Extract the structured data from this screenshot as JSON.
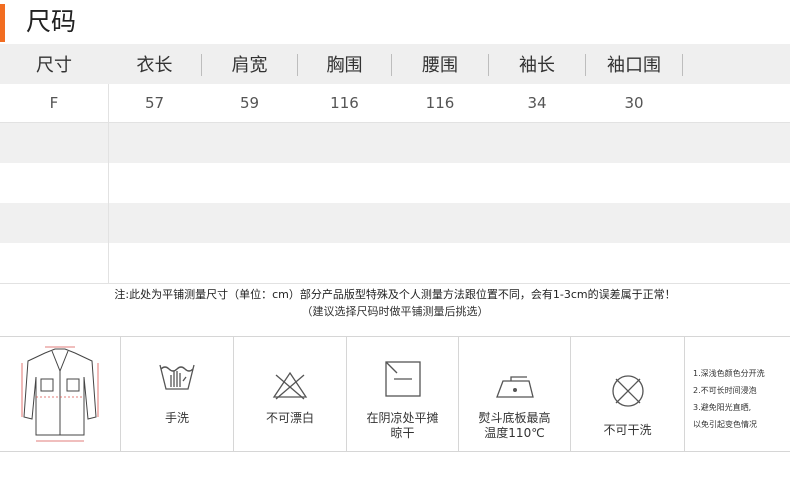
{
  "title": "尺码",
  "table": {
    "headers": [
      "尺寸",
      "衣长",
      "肩宽",
      "胸围",
      "腰围",
      "袖长",
      "袖口围"
    ],
    "rows": [
      [
        "F",
        "57",
        "59",
        "116",
        "116",
        "34",
        "30"
      ]
    ]
  },
  "note": {
    "line1": "注:此处为平铺测量尺寸（单位：cm）部分产品版型特殊及个人测量方法跟位置不同，会有1-3cm的误差属于正常！",
    "line2": "（建议选择尺码时做平铺测量后挑选）"
  },
  "care": {
    "items": [
      {
        "label": "手洗",
        "icon": "hand-wash-icon"
      },
      {
        "label": "不可漂白",
        "icon": "no-bleach-icon"
      },
      {
        "label": "在阴凉处平摊",
        "label2": "晾干",
        "icon": "dry-flat-shade-icon"
      },
      {
        "label": "熨斗底板最高",
        "label2": "温度110℃",
        "icon": "iron-low-icon"
      },
      {
        "label": "不可干洗",
        "icon": "no-dry-clean-icon"
      }
    ],
    "tips": [
      "1.深浅色颜色分开洗",
      "2.不可长时间浸泡",
      "3.避免阳光直晒,",
      "以免引起变色情况"
    ]
  },
  "colors": {
    "accent": "#f26d21",
    "header_bg": "#efefef"
  }
}
